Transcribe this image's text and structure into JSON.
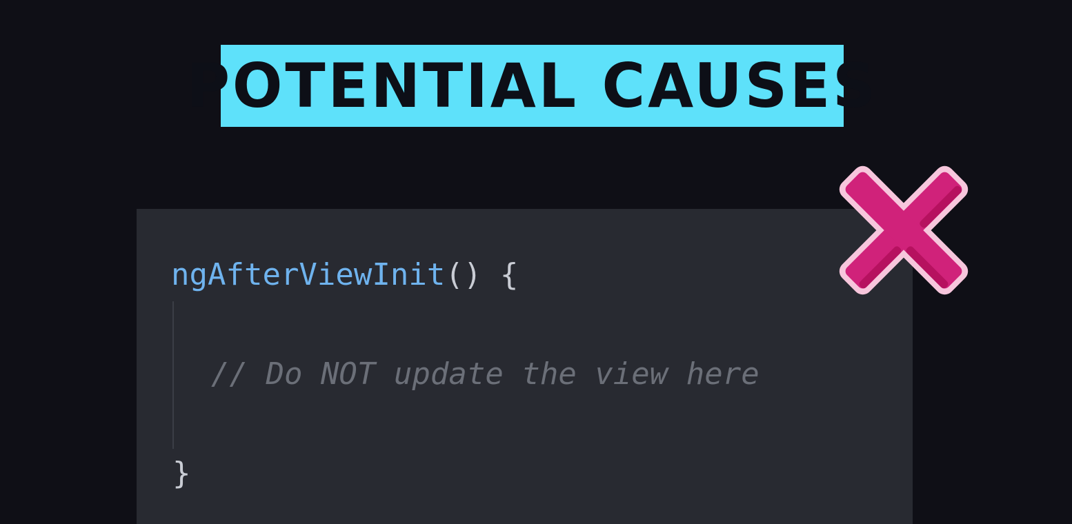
{
  "title": "POTENTIAL CAUSES",
  "code": {
    "function_name": "ngAfterViewInit",
    "function_parens": "()",
    "open_brace": " {",
    "comment": "// Do NOT update the view here",
    "close_brace": "}"
  },
  "colors": {
    "background": "#0f0f16",
    "banner": "#5ee1fa",
    "code_panel": "#282a31",
    "function_name": "#6fb3ee",
    "comment": "#6b6f78",
    "x_mark_fill": "#d0227a",
    "x_mark_outline": "#f7c6dc"
  },
  "icons": {
    "status": "x-mark-icon"
  }
}
